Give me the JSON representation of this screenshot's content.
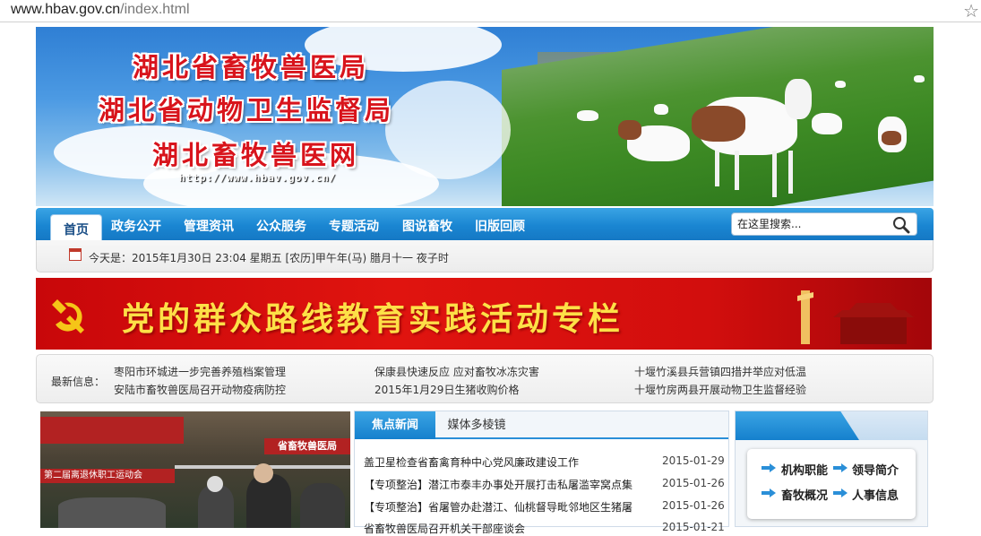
{
  "browser": {
    "url_host": "www.hbav.gov.cn",
    "url_path": "/index.html",
    "bookmark_icon": "star-icon"
  },
  "banner": {
    "line1": "湖北省畜牧兽医局",
    "line2": "湖北省动物卫生监督局",
    "line3": "湖北畜牧兽医网",
    "site_url": "http://www.hbav.gov.cn/"
  },
  "nav": {
    "items": [
      "首页",
      "政务公开",
      "管理资讯",
      "公众服务",
      "专题活动",
      "图说畜牧",
      "旧版回顾"
    ],
    "search_placeholder": "在这里搜索..."
  },
  "datebar": {
    "text": "今天是：2015年1月30日 23:04 星期五 [农历]甲午年(马) 腊月十一 夜子时"
  },
  "campaign": {
    "title": "党的群众路线教育实践活动专栏"
  },
  "latest": {
    "label": "最新信息：",
    "items": [
      "枣阳市环城进一步完善养殖档案管理",
      "保康县快速反应 应对畜牧冰冻灾害",
      "十堰竹溪县兵营镇四措并举应对低温",
      "安陆市畜牧兽医局召开动物疫病防控",
      "2015年1月29日生猪收购价格",
      "十堰竹房两县开展动物卫生监督经验"
    ]
  },
  "news_tabs": {
    "tabs": [
      "焦点新闻",
      "媒体多棱镜"
    ],
    "items": [
      {
        "title": "盖卫星检查省畜禽育种中心党风廉政建设工作",
        "date": "2015-01-29"
      },
      {
        "title": "【专项整治】潜江市泰丰办事处开展打击私屠滥宰窝点集",
        "date": "2015-01-26"
      },
      {
        "title": "【专项整治】省屠管办赴潜江、仙桃督导毗邻地区生猪屠",
        "date": "2015-01-26"
      },
      {
        "title": "省畜牧兽医局召开机关干部座谈会",
        "date": "2015-01-21"
      }
    ]
  },
  "photo": {
    "sign1": "省畜牧兽医局",
    "sign2": "第二届离退休职工运动会"
  },
  "side_links": [
    "机构职能",
    "领导简介",
    "畜牧概况",
    "人事信息"
  ],
  "colors": {
    "nav_blue": "#1a86d2",
    "banner_red": "#d20e0d",
    "title_yellow": "#fde047"
  }
}
